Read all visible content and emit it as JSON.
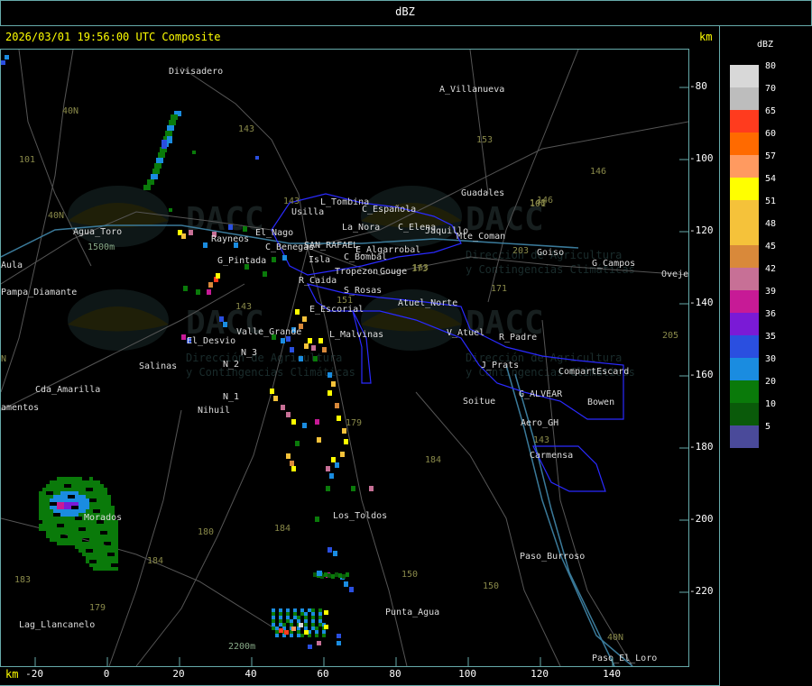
{
  "window": {
    "title": "dBZ"
  },
  "header": {
    "timestamp": "2026/03/01 19:56:00 UTC Composite",
    "km_label": "km"
  },
  "axes": {
    "x_unit": "km",
    "x_ticks": [
      "-20",
      "0",
      "20",
      "40",
      "60",
      "80",
      "100",
      "120",
      "140"
    ],
    "y_ticks": [
      "-80",
      "-100",
      "-120",
      "-140",
      "-160",
      "-180",
      "-200",
      "-220"
    ]
  },
  "legend": {
    "title": "dBZ",
    "items": [
      {
        "label": "80",
        "color": "#d8d8d8"
      },
      {
        "label": "70",
        "color": "#bdbdbd"
      },
      {
        "label": "65",
        "color": "#ff3b1e"
      },
      {
        "label": "60",
        "color": "#ff6a00"
      },
      {
        "label": "57",
        "color": "#ff9a60"
      },
      {
        "label": "54",
        "color": "#ffff00"
      },
      {
        "label": "51",
        "color": "#f5c23a"
      },
      {
        "label": "48",
        "color": "#f5c23a"
      },
      {
        "label": "45",
        "color": "#d9893a"
      },
      {
        "label": "42",
        "color": "#c77096"
      },
      {
        "label": "39",
        "color": "#c71a96"
      },
      {
        "label": "36",
        "color": "#7a1ad6"
      },
      {
        "label": "35",
        "color": "#2a4fe0"
      },
      {
        "label": "30",
        "color": "#1a8ce0"
      },
      {
        "label": "20",
        "color": "#0a7a0a"
      },
      {
        "label": "10",
        "color": "#0a5a0a"
      },
      {
        "label": "5",
        "color": "#4a4a9a"
      }
    ]
  },
  "watermark": {
    "brand": "DACC",
    "line1": "Dirección de Agricultura",
    "line2": "y Contingencias Climáticas"
  },
  "places": [
    {
      "name": "Divisadero"
    },
    {
      "name": "A_Villanueva"
    },
    {
      "name": "Guadales"
    },
    {
      "name": "L_Tombina"
    },
    {
      "name": "Usilla"
    },
    {
      "name": "C_Española"
    },
    {
      "name": "La_Nora"
    },
    {
      "name": "C_Elena"
    },
    {
      "name": "Jaquillo"
    },
    {
      "name": "Mte_Coman"
    },
    {
      "name": "Agua_Toro"
    },
    {
      "name": "Goiso"
    },
    {
      "name": "G_Campos"
    },
    {
      "name": "Ovejeros"
    },
    {
      "name": "Rayneos"
    },
    {
      "name": "El_Nago"
    },
    {
      "name": "C_Benegas"
    },
    {
      "name": "SAN_RAFAEL"
    },
    {
      "name": "E_Algarrobal"
    },
    {
      "name": "C_Bombal"
    },
    {
      "name": "Isla"
    },
    {
      "name": "G_Pintada"
    },
    {
      "name": "Tropezon"
    },
    {
      "name": "Gouge"
    },
    {
      "name": "R_Caida"
    },
    {
      "name": "S_Rosas"
    },
    {
      "name": "Atuel_Norte"
    },
    {
      "name": "Pampa_Diamante"
    },
    {
      "name": "E_Escorial"
    },
    {
      "name": "V_Atuel"
    },
    {
      "name": "R_Padre"
    },
    {
      "name": "Valle_Grande"
    },
    {
      "name": "L_Malvinas"
    },
    {
      "name": "El_Desvio"
    },
    {
      "name": "J_Prats"
    },
    {
      "name": "CompartEscard"
    },
    {
      "name": "Salinas"
    },
    {
      "name": "N_2"
    },
    {
      "name": "N_3"
    },
    {
      "name": "N_1"
    },
    {
      "name": "Cda_Amarilla"
    },
    {
      "name": "G_ALVEAR"
    },
    {
      "name": "Soitue"
    },
    {
      "name": "Bowen"
    },
    {
      "name": "Nihuil"
    },
    {
      "name": "Aero_GH"
    },
    {
      "name": "Carmensa"
    },
    {
      "name": "Los_Toldos"
    },
    {
      "name": "Morados"
    },
    {
      "name": "Paso_Burroso"
    },
    {
      "name": "Lag_Llancanelo"
    },
    {
      "name": "Punta_Agua"
    },
    {
      "name": "Paso_El_Loro"
    },
    {
      "name": "Aula"
    },
    {
      "name": "amentos"
    }
  ],
  "road_numbers": [
    "143",
    "153",
    "146",
    "101",
    "40N",
    "40N",
    "143",
    "146",
    "101",
    "173",
    "171",
    "143",
    "148",
    "163",
    "203",
    "205",
    "151",
    "179",
    "184",
    "150",
    "180",
    "184",
    "184",
    "183",
    "179",
    "150",
    "143",
    "40N",
    "N"
  ],
  "elevation_labels": [
    "1500m",
    "2200m"
  ]
}
